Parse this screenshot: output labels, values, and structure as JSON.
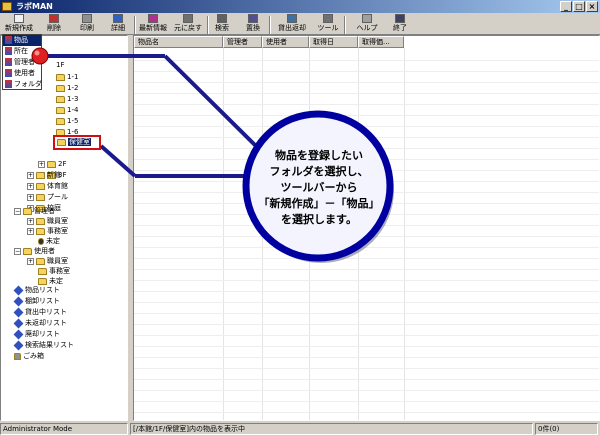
{
  "window": {
    "title": "ラボMAN",
    "controls": [
      "_",
      "□",
      "×"
    ]
  },
  "toolbar": [
    {
      "id": "new",
      "label": "新規作成",
      "icon": "new-doc-icon"
    },
    {
      "id": "delete",
      "label": "削除",
      "icon": "delete-icon"
    },
    {
      "id": "print",
      "label": "印刷",
      "icon": "printer-icon"
    },
    {
      "id": "detail",
      "label": "詳細",
      "icon": "detail-icon"
    },
    {
      "id": "latest",
      "label": "最新情報",
      "icon": "refresh-icon"
    },
    {
      "id": "undo",
      "label": "元に戻す",
      "icon": "undo-icon"
    },
    {
      "id": "search",
      "label": "検索",
      "icon": "search-icon"
    },
    {
      "id": "replace",
      "label": "置換",
      "icon": "replace-icon"
    },
    {
      "id": "lending",
      "label": "貸出返却",
      "icon": "lending-icon"
    },
    {
      "id": "tools",
      "label": "ツール",
      "icon": "tools-icon"
    },
    {
      "id": "help",
      "label": "ヘルプ",
      "icon": "help-icon"
    },
    {
      "id": "exit",
      "label": "終了",
      "icon": "exit-icon"
    }
  ],
  "new_menu": {
    "items": [
      {
        "label": "物品",
        "selected": true
      },
      {
        "label": "所在",
        "selected": false
      },
      {
        "label": "管理者",
        "selected": false
      },
      {
        "label": "使用者",
        "selected": false
      },
      {
        "label": "フォルダ",
        "selected": false
      }
    ]
  },
  "tree": {
    "floor_label": "1F",
    "rooms": [
      "1-1",
      "1-2",
      "1-3",
      "1-4",
      "1-5",
      "1-6"
    ],
    "partial_room": "",
    "highlighted": "保健室",
    "floors": [
      "2F",
      "3F"
    ],
    "buildings": [
      "新館",
      "体育館",
      "プール",
      "校庭"
    ],
    "managers": {
      "label": "管理者",
      "children": [
        "職員室",
        "事務室",
        "未定"
      ]
    },
    "users": {
      "label": "使用者",
      "children": [
        "職員室",
        "事務室",
        "未定"
      ]
    },
    "lists": [
      "物品リスト",
      "棚卸リスト",
      "貸出中リスト",
      "未返却リスト",
      "廃却リスト",
      "検索結果リスト"
    ],
    "trash": "ごみ箱"
  },
  "table": {
    "columns": [
      "物品名",
      "管理者",
      "使用者",
      "取得日",
      "取得価..."
    ]
  },
  "callout": {
    "lines": [
      "物品を登録したい",
      "フォルダを選択し、",
      "ツールバーから",
      "「新規作成」－「物品」",
      "を選択します。"
    ]
  },
  "status": {
    "mode": "Administrator Mode",
    "path_message": "[/本館/1F/保健室]内の物品を表示中",
    "count": "0件(0)"
  },
  "colors": {
    "titlebar": "#0a246a",
    "annotation_line": "#1a1a8c",
    "callout_ring": "#0000a0",
    "highlight": "#d01010",
    "pin": "#e02020"
  }
}
